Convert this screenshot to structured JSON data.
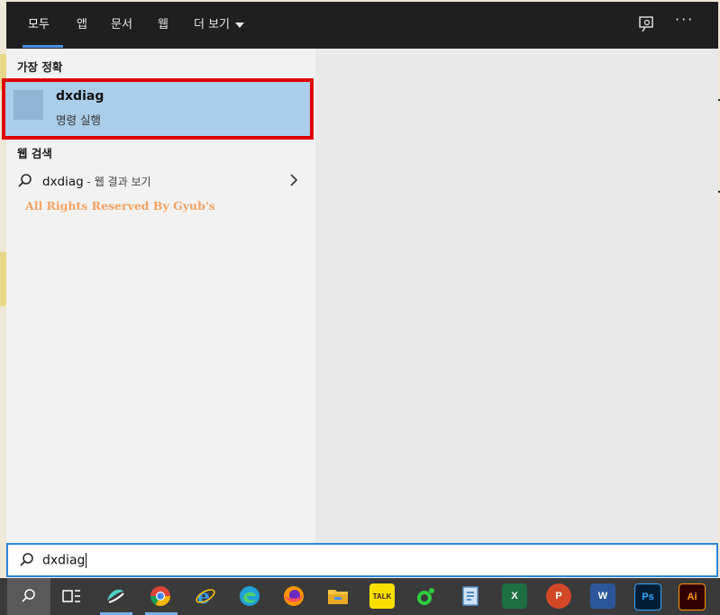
{
  "tabs": [
    {
      "label": "모두",
      "active": true
    },
    {
      "label": "앱",
      "active": false
    },
    {
      "label": "문서",
      "active": false
    },
    {
      "label": "웹",
      "active": false
    },
    {
      "label": "더 보기",
      "active": false
    }
  ],
  "top_icons": [
    "feedback-icon",
    "more-options-icon"
  ],
  "best_match": {
    "section_label": "가장 정확",
    "title": "dxdiag",
    "subtitle": "명령 실행",
    "icon": "app-icon"
  },
  "web_search": {
    "section_label": "웹 검색",
    "query": "dxdiag",
    "suffix": " - 웹 결과 보기"
  },
  "watermark": "All Rights Reserved By Gyub's",
  "search": {
    "value": "dxdiag"
  },
  "taskbar": {
    "apps": [
      {
        "name": "search-icon",
        "color": "#595959"
      },
      {
        "name": "task-view-icon"
      },
      {
        "name": "app-swirl-icon"
      },
      {
        "name": "chrome-icon"
      },
      {
        "name": "internet-explorer-icon"
      },
      {
        "name": "edge-icon"
      },
      {
        "name": "firefox-icon"
      },
      {
        "name": "file-explorer-icon"
      },
      {
        "name": "kakaotalk-icon",
        "label": "TALK"
      },
      {
        "name": "green-app-icon"
      },
      {
        "name": "document-app-icon"
      },
      {
        "name": "excel-icon",
        "label": "X"
      },
      {
        "name": "powerpoint-icon",
        "label": "P"
      },
      {
        "name": "word-icon",
        "label": "W"
      },
      {
        "name": "photoshop-icon",
        "label": "Ps"
      },
      {
        "name": "illustrator-icon",
        "label": "Ai"
      }
    ]
  },
  "colors": {
    "accent": "#2b88d8",
    "highlight_border": "#e00000",
    "best_match_bg": "#aacde9",
    "watermark": "#f4a261"
  }
}
